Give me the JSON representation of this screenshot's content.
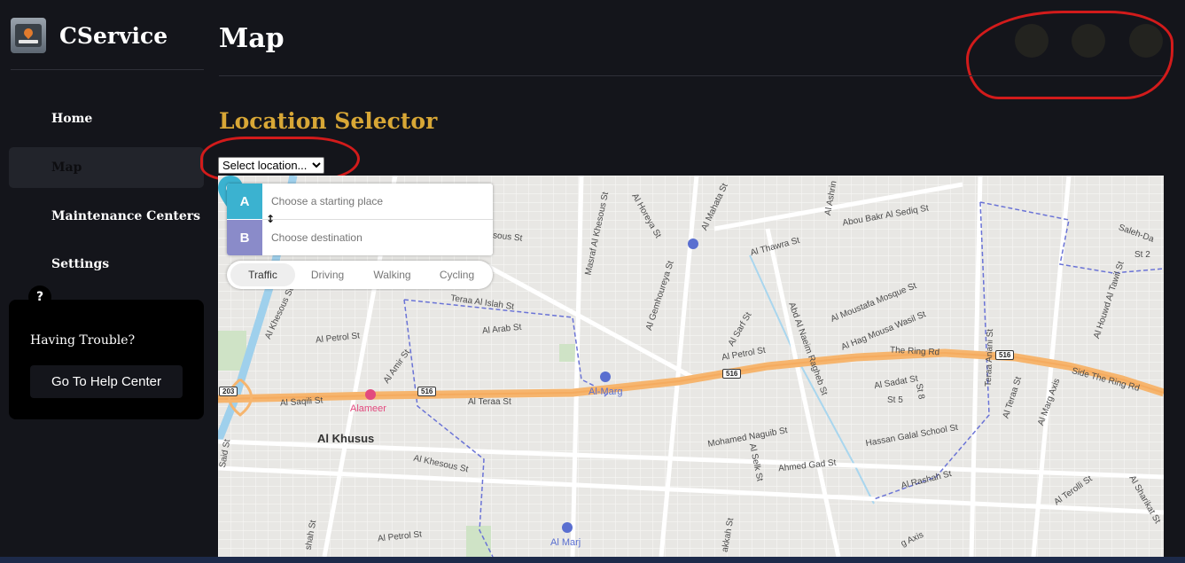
{
  "brand": {
    "name": "CService",
    "logo_icon": "car-service-logo-icon"
  },
  "sidebar": {
    "items": [
      {
        "label": "Home",
        "active": false
      },
      {
        "label": "Map",
        "active": true
      },
      {
        "label": "Maintenance Centers",
        "active": false
      },
      {
        "label": "Settings",
        "active": false
      }
    ],
    "help": {
      "badge": "?",
      "title": "Having Trouble?",
      "button": "Go To Help Center"
    }
  },
  "header": {
    "title": "Map"
  },
  "location": {
    "title": "Location Selector",
    "select_value": "Select location..."
  },
  "map": {
    "directions": {
      "a_label": "A",
      "b_label": "B",
      "start_placeholder": "Choose a starting place",
      "dest_placeholder": "Choose destination"
    },
    "modes": [
      "Traffic",
      "Driving",
      "Walking",
      "Cycling"
    ],
    "active_mode": "Traffic",
    "labels": {
      "khusus": "Al Khusus",
      "alameer": "Alameer",
      "almarg": "Al-Marg",
      "almarj": "Al Marj",
      "saqili": "Al Saqili St",
      "teraa1": "Al Teraa St",
      "petrol1": "Al Petrol St",
      "petrol2": "Al Petrol St",
      "petrol3": "Al Petrol St",
      "arab": "Al Arab St",
      "islah": "Teraa Al Islah St",
      "amir": "Al Amir St",
      "khesous": "Al Khesous St",
      "ringrd": "The Ring Rd",
      "sidering": "Side The Ring Rd",
      "naguib": "Mohamed Naguib St",
      "gad": "Ahmed Gad St",
      "selk": "Al Selk St",
      "sadat": "Al Sadat St",
      "st5": "St 5",
      "st8": "St 8",
      "hassan": "Hassan Galal School St",
      "rashah": "Al Rashah St",
      "abubakr": "Abou Bakr Al Sediq St",
      "thawra": "Al Thawra St",
      "moustafa": "Al Moustafa Mosque St",
      "hagmousa": "Al Hag Mousa Wasil St",
      "naeem": "Abd Al Naeim Ragheb St",
      "sarf": "Al Sarf St",
      "gemhoureya": "Al Gemhoureya St",
      "horeya": "Al Horeya St",
      "mahata": "Al Mahata St",
      "masraf": "Masraf Al Khesous St",
      "teraaanani": "Teraa Anani St",
      "alteraa2": "Al Teraa St",
      "margaxis": "Al Marg Axis",
      "terolli": "Al Terolli St",
      "sharikat": "Al Sharikat St",
      "houwd": "Al Houwd Al Tawil St",
      "salehd": "Saleh-Da",
      "st2": "St 2",
      "khesoust2": "Al Khesous St",
      "ashrin": "Al Ashrin",
      "ousst": "sous St",
      "shahst": "shah St",
      "akkahst": "akkah St",
      "axis": "g Axis",
      "said": "Said St",
      "r516a": "516",
      "r516b": "516",
      "r516c": "516",
      "r203": "203"
    }
  }
}
